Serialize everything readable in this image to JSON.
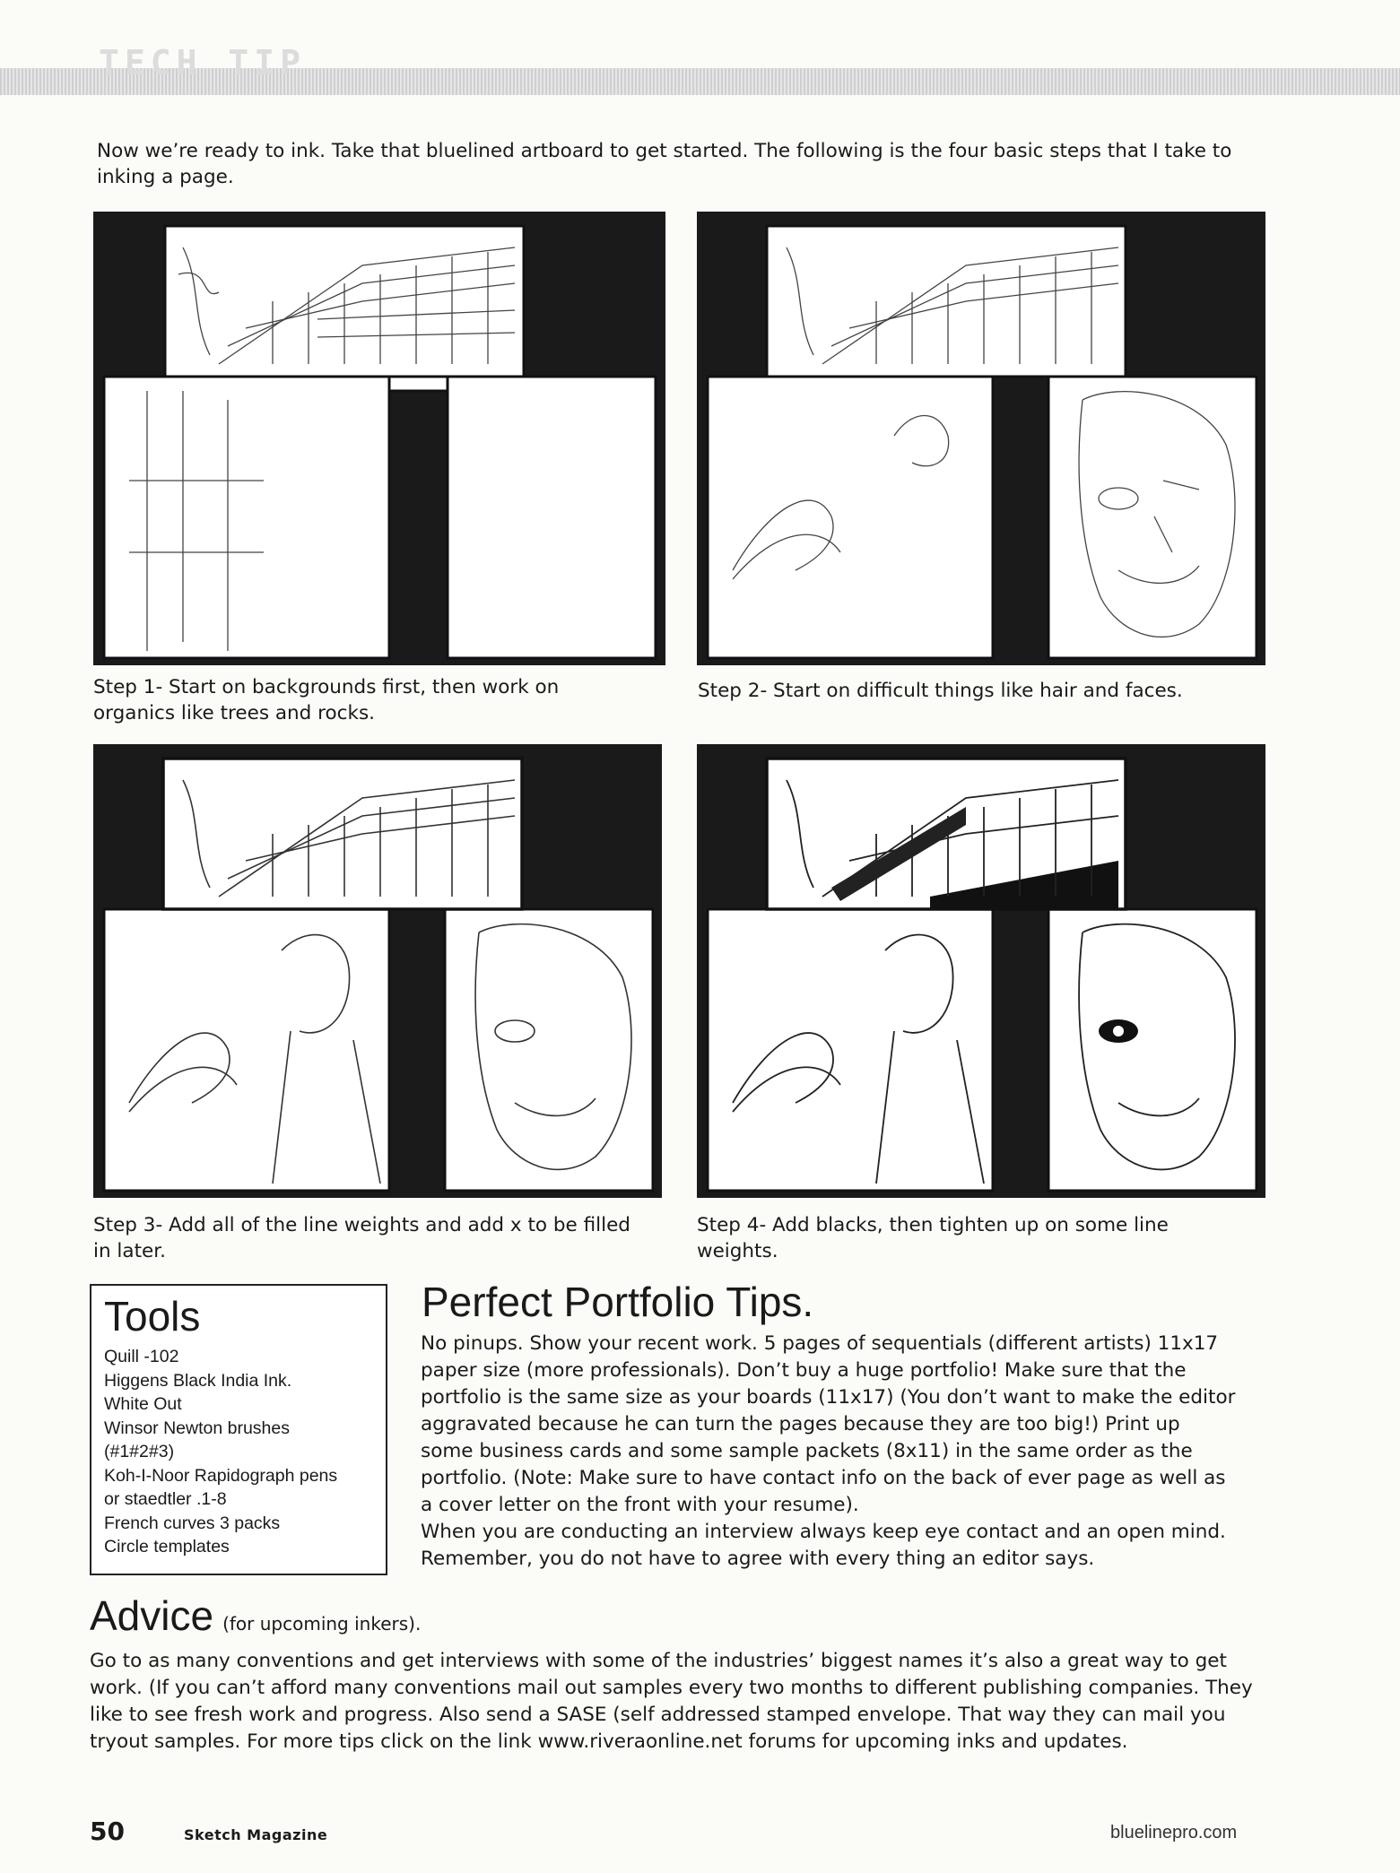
{
  "header": {
    "section_tag": "TECH TIP"
  },
  "intro": "Now we’re ready to ink. Take that bluelined artboard to get started. The following is the four basic steps that I take to inking a page.",
  "steps": [
    {
      "caption": "Step 1- Start on backgrounds first, then work on organics like trees and rocks."
    },
    {
      "caption": "Step 2- Start on difficult things like hair and faces."
    },
    {
      "caption": "Step 3- Add all of the line weights and add x to be filled in later."
    },
    {
      "caption": "Step 4- Add blacks, then tighten up on some line weights."
    }
  ],
  "tools": {
    "title": "Tools",
    "items": [
      "Quill -102",
      "Higgens Black India Ink.",
      "White Out",
      "Winsor Newton brushes",
      "(#1#2#3)",
      "Koh-I-Noor Rapidograph pens",
      "or staedtler .1-8",
      "French curves 3 packs",
      "Circle templates"
    ]
  },
  "portfolio": {
    "title": "Perfect Portfolio Tips.",
    "body": "No pinups. Show your recent work. 5 pages of sequentials (different artists) 11x17 paper size (more professionals). Don’t buy a huge portfolio! Make sure that the portfolio is the same size as your boards (11x17) (You don’t want to make the editor aggravated because he can turn the pages because they are too big!) Print up some business cards and some sample packets (8x11) in the same order as the portfolio. (Note: Make sure to have contact info on the back of ever page as well as a cover letter on the front with your resume).",
    "body2": "When you are conducting an interview always keep eye contact and an open mind. Remember, you do not have to agree with every thing an editor says."
  },
  "advice": {
    "title": "Advice",
    "subtitle": "(for upcoming inkers).",
    "body": "Go to as many conventions and get interviews with some of the industries’ biggest names it’s also a great way to get work. (If you can’t afford many conventions mail out samples every two months to different publishing companies. They like to see fresh work and progress. Also send a SASE (self addressed stamped envelope. That way they can mail you tryout samples. For more tips click on the link www.riveraonline.net forums for upcoming inks and updates."
  },
  "footer": {
    "page_number": "50",
    "magazine": "Sketch Magazine",
    "site": "bluelinepro.com"
  }
}
